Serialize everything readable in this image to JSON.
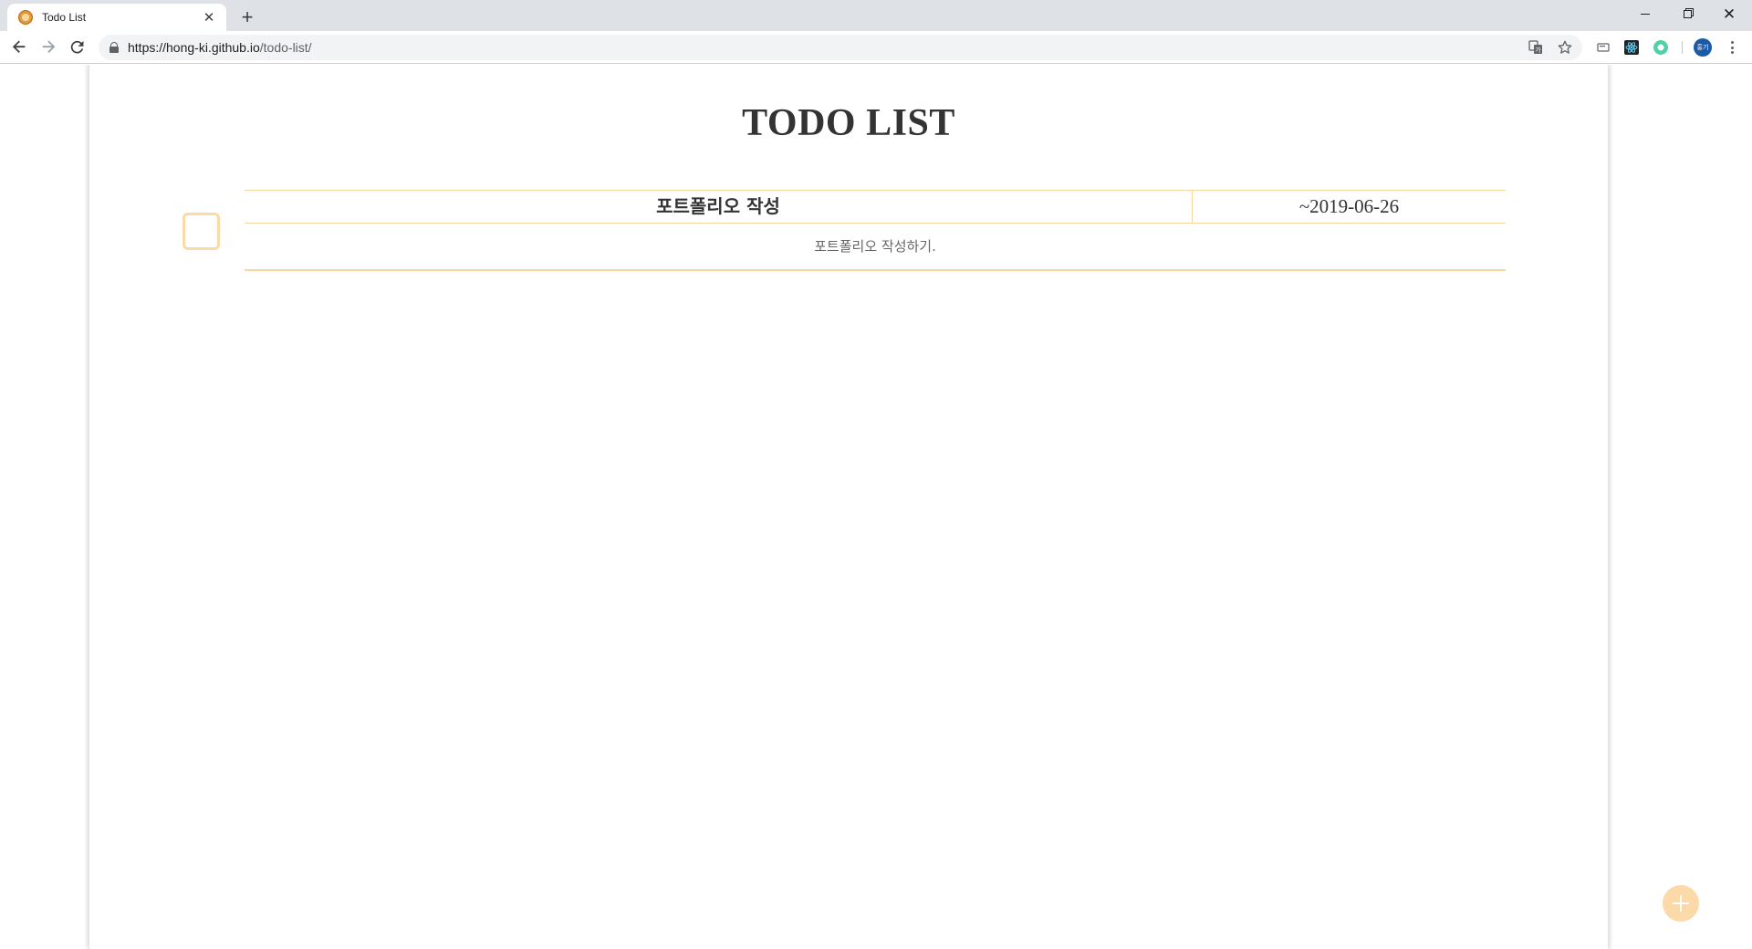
{
  "browser": {
    "tab": {
      "title": "Todo List",
      "close_glyph": "✕"
    },
    "new_tab_glyph": "+",
    "window_controls": {
      "close_glyph": "✕"
    },
    "address": {
      "host": "https://hong-ki.github.io",
      "path": "/todo-list/"
    },
    "profile_initials": "홍기",
    "icons": [
      "favicon",
      "close-icon",
      "plus-icon",
      "minimize-icon",
      "maximize-icon",
      "back-arrow-icon",
      "forward-arrow-icon",
      "reload-icon",
      "lock-icon",
      "translate-icon",
      "star-icon",
      "cast-icon",
      "react-devtools-icon",
      "extension-icon",
      "profile-avatar",
      "more-menu-icon"
    ]
  },
  "page": {
    "title": "TODO LIST",
    "todos": [
      {
        "title": "포트폴리오 작성",
        "due": "~2019-06-26",
        "description": "포트폴리오 작성하기.",
        "done": false
      }
    ],
    "accent_color": "#fbd9a8",
    "border_color": "#f9d6a2"
  }
}
